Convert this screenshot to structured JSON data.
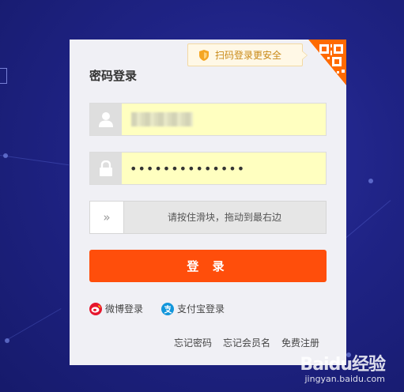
{
  "login": {
    "title": "密码登录",
    "qr_tip": "扫码登录更安全",
    "username_value": "",
    "password_value": "••••••••••••••",
    "slider_hint": "请按住滑块，拖动到最右边",
    "slider_handle_glyph": "»",
    "submit_label": "登 录",
    "weibo_label": "微博登录",
    "alipay_label": "支付宝登录",
    "forgot_password": "忘记密码",
    "forgot_username": "忘记会员名",
    "register": "免费注册"
  },
  "icons": {
    "qr_tip": "shield-icon",
    "qr_corner": "qrcode-icon",
    "username": "user-icon",
    "password": "lock-icon",
    "weibo": "weibo-icon",
    "alipay": "alipay-icon"
  },
  "colors": {
    "primary_button": "#ff4e0b",
    "input_autofill": "#ffffc0",
    "qr_orange": "#ff6a00",
    "background": "#1f2385",
    "weibo_red": "#e6162d",
    "alipay_blue": "#1296db"
  },
  "watermark": {
    "logo": "Baidu经验",
    "sub": "jingyan.baidu.com"
  }
}
